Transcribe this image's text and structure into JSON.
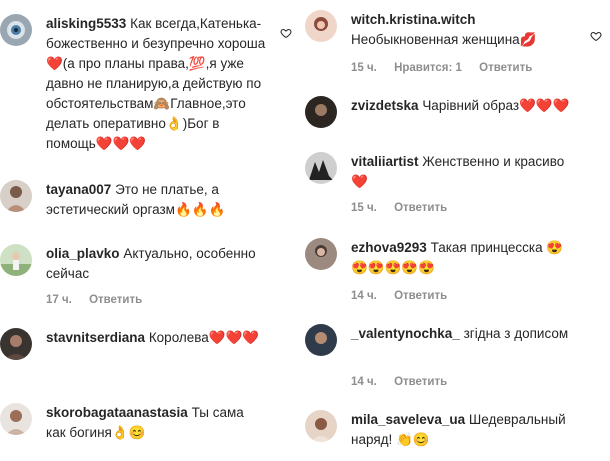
{
  "left": [
    {
      "user": "alisking5533",
      "text": "Как всегда,Катенька-божественно и безупречно хороша❤️(а про планы права,💯,я уже давно не планирую,а действую по обстоятельствам🙈Главное,это делать оперативно👌)Бог в помощь❤️❤️❤️",
      "time": "",
      "reply": ""
    },
    {
      "user": "tayana007",
      "text": "Это не платье, а эстетический оргазм🔥🔥🔥",
      "time": "",
      "reply": ""
    },
    {
      "user": "olia_plavko",
      "text": "Актуально, особенно сейчас",
      "time": "17 ч.",
      "reply": "Ответить"
    },
    {
      "user": "stavnitserdiana",
      "text": "Королева❤️❤️❤️",
      "time": "",
      "reply": ""
    },
    {
      "user": "skorobagataanastasia",
      "text": "Ты сама как богиня👌😊",
      "time": "",
      "reply": ""
    }
  ],
  "right": [
    {
      "user": "witch.kristina.witch",
      "text": "Необыкновенная женщина💋",
      "time": "15 ч.",
      "likes": "Нравится: 1",
      "reply": "Ответить"
    },
    {
      "user": "zvizdetska",
      "text": "Чарівний образ❤️❤️❤️",
      "time": "",
      "likes": "",
      "reply": ""
    },
    {
      "user": "vitaliiartist",
      "text": "Женственно и красиво❤️",
      "time": "15 ч.",
      "likes": "",
      "reply": "Ответить"
    },
    {
      "user": "ezhova9293",
      "text": "Такая принцесска 😍😍😍😍😍😍",
      "time": "14 ч.",
      "likes": "",
      "reply": "Ответить"
    },
    {
      "user": "_valentynochka_",
      "text": "згідна з дописом",
      "time": "14 ч.",
      "likes": "",
      "reply": "Ответить"
    },
    {
      "user": "mila_saveleva_ua",
      "text": "Шедевральный наряд! 👏😊",
      "time": "",
      "likes": "",
      "reply": ""
    }
  ],
  "colors": {
    "text": "#262626",
    "meta": "#8e8e8e",
    "heart": "#e0245e"
  },
  "icons": {
    "like": "heart-outline-icon"
  }
}
